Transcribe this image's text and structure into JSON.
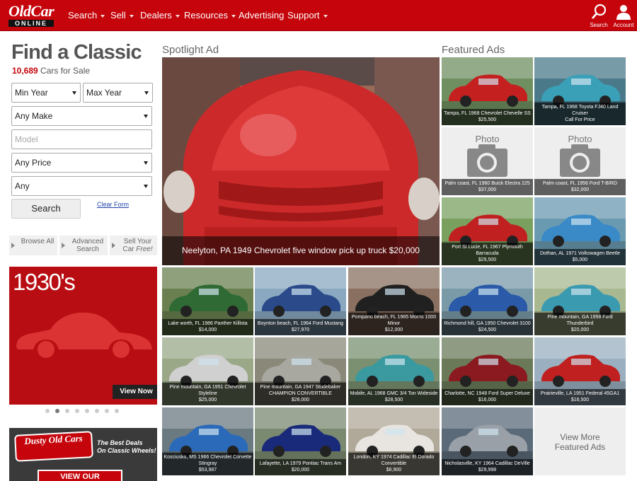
{
  "nav": {
    "logo_top": "OldCar",
    "logo_bottom": "ONLINE",
    "items": [
      {
        "label": "Search",
        "has_caret": true
      },
      {
        "label": "Sell",
        "has_caret": true
      },
      {
        "label": "Dealers",
        "has_caret": true
      },
      {
        "label": "Resources",
        "has_caret": true
      },
      {
        "label": "Advertising",
        "has_caret": false
      },
      {
        "label": "Support",
        "has_caret": true
      }
    ],
    "search_icon_label": "Search",
    "account_icon_label": "Account",
    "brand_color": "#c5040b"
  },
  "finder": {
    "title": "Find a Classic",
    "count": "10,689",
    "count_suffix": "Cars for Sale",
    "min_year": "Min Year",
    "max_year": "Max Year",
    "make": "Any Make",
    "model_placeholder": "Model",
    "price": "Any Price",
    "any": "Any",
    "search_button": "Search",
    "clear_form": "Clear Form",
    "browse_all": "Browse All",
    "advanced_search": "Advanced Search",
    "sell_your_car": "Sell Your",
    "sell_your_car2": "Car",
    "sell_free": "Free!"
  },
  "promo": {
    "title": "1930's",
    "button": "View Now",
    "dots_total": 8,
    "dots_active": 1
  },
  "dusty": {
    "logo": "Dusty Old Cars",
    "tagline1": "The Best Deals",
    "tagline2": "On Classic Wheels!",
    "button": "VIEW OUR"
  },
  "spotlight": {
    "heading": "Spotlight Ad",
    "caption": "Neelyton, PA 1949 Chevrolet five window pick up truck $20,000"
  },
  "featured": {
    "heading": "Featured Ads",
    "photo_label": "Photo",
    "view_more": "View More Featured Ads",
    "tiles": [
      {
        "title": "Tampa, FL 1968 Chevrolet Chevelle SS",
        "price": "$25,500",
        "bg": "#6f8f60",
        "car": "#c52020"
      },
      {
        "title": "Tampa, FL 1968 Toyota FJ40 Land Cruiser",
        "price": "Call For Price",
        "bg": "#4a7a8a",
        "car": "#3aa0b8"
      },
      {
        "title": "Palm coast, FL 1960 Buick Electra 225",
        "price": "$37,000",
        "bg": "#eeeeee",
        "car": "",
        "placeholder": true
      },
      {
        "title": "Palm coast, FL 1956 Ford T-BIRD",
        "price": "$32,000",
        "bg": "#eeeeee",
        "car": "",
        "placeholder": true
      },
      {
        "title": "Port St Lucie, FL 1967 Plymouth Barracuda",
        "price": "$29,500",
        "bg": "#7aa060",
        "car": "#c02020"
      },
      {
        "title": "Dothan, AL 1971 Volkswagen Beetle",
        "price": "$5,000",
        "bg": "#6a9ab0",
        "car": "#3a8ac8"
      },
      {
        "title": "Lake worth, FL 1986 Panther Killista",
        "price": "$14,000",
        "bg": "#6a8050",
        "car": "#2f6a35"
      },
      {
        "title": "Boynton beach, FL 1964 Ford Mustang",
        "price": "$27,970",
        "bg": "#8aa8c0",
        "car": "#2a4a8a"
      },
      {
        "title": "Pompano beach, FL 1965 Morris 1000 Minor",
        "price": "$12,000",
        "bg": "#8a7060",
        "car": "#202020"
      },
      {
        "title": "Richmond hill, GA 1950 Chevrolet 3100",
        "price": "$24,500",
        "bg": "#7a9aa8",
        "car": "#2a5aa8"
      },
      {
        "title": "Pine mountain, GA 1958 Ford Thunderbird",
        "price": "$20,000",
        "bg": "#a8b890",
        "car": "#3a9ab0"
      },
      {
        "title": "Pine mountain, GA 1951 Chevrolet Styleline",
        "price": "$25,000",
        "bg": "#9aa888",
        "car": "#d0d0d0"
      },
      {
        "title": "Pine mountain, GA 1947 Studebaker CHAMPION CONVERTIBLE",
        "price": "$28,000",
        "bg": "#8a8878",
        "car": "#a8a8a0"
      },
      {
        "title": "Mobile, AL 1968 GMC 3/4 Ton Wideside",
        "price": "$28,500",
        "bg": "#7a9070",
        "car": "#3a9aa0"
      },
      {
        "title": "Charlotte, NC 1948 Ford Super Deluxe",
        "price": "$16,000",
        "bg": "#6a7a58",
        "car": "#8a1a20"
      },
      {
        "title": "Prairieville, LA 1951 Federal 45GA1",
        "price": "$16,500",
        "bg": "#9ab0c0",
        "car": "#c02020"
      },
      {
        "title": "Kosciusko, MS 1966 Chevrolet Corvette Stingray",
        "price": "$53,987",
        "bg": "#6a7a80",
        "car": "#2a6ab8"
      },
      {
        "title": "Lafayette, LA 1979 Pontiac Trans Am",
        "price": "$20,000",
        "bg": "#7a8a70",
        "car": "#1a2a7a"
      },
      {
        "title": "London, KY 1974 Cadillac El Dorado Convertible",
        "price": "$6,900",
        "bg": "#b0a898",
        "car": "#e8e4e0"
      },
      {
        "title": "Nicholasville, KY 1964 Cadillac DeVille",
        "price": "$29,998",
        "bg": "#5a6a78",
        "car": "#9aa0a8"
      }
    ]
  }
}
